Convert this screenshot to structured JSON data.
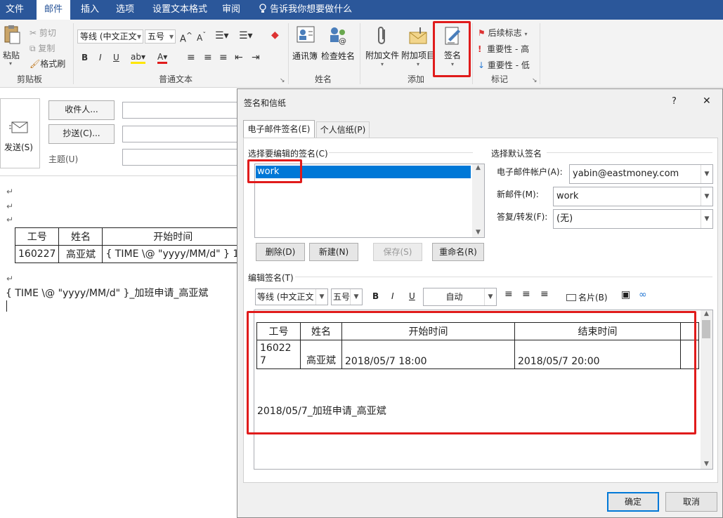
{
  "menu": {
    "tabs": [
      "文件",
      "邮件",
      "插入",
      "选项",
      "设置文本格式",
      "审阅"
    ],
    "tell_me": "告诉我你想要做什么"
  },
  "ribbon": {
    "clipboard": {
      "paste": "粘贴",
      "cut": "剪切",
      "copy": "复制",
      "format_painter": "格式刷",
      "label": "剪贴板"
    },
    "basic_text": {
      "font": "等线 (中文正文",
      "size": "五号",
      "label": "普通文本"
    },
    "names": {
      "address_book": "通讯簿",
      "check_names": "检查姓名",
      "label": "姓名"
    },
    "include": {
      "attach_file": "附加文件",
      "attach_item": "附加项目",
      "signature": "签名",
      "label": "添加"
    },
    "tags": {
      "follow_up": "后续标志",
      "high": "重要性 - 高",
      "low": "重要性 - 低",
      "label": "标记"
    }
  },
  "compose": {
    "send": "发送(S)",
    "to": "收件人...",
    "cc": "抄送(C)...",
    "subject": "主题(U)",
    "table": {
      "headers": [
        "工号",
        "姓名",
        "开始时间"
      ],
      "row": [
        "160227",
        "高亚斌",
        "{ TIME \\@ \"yyyy/MM/d\" } 1"
      ]
    },
    "body_line": "{ TIME \\@ \"yyyy/MM/d\" }_加班申请_高亚斌"
  },
  "dialog": {
    "title": "签名和信纸",
    "help": "?",
    "close": "✕",
    "tabs": [
      "电子邮件签名(E)",
      "个人信纸(P)"
    ],
    "select_label": "选择要编辑的签名(C)",
    "signatures": [
      "work"
    ],
    "buttons": {
      "delete": "删除(D)",
      "new": "新建(N)",
      "save": "保存(S)",
      "rename": "重命名(R)"
    },
    "default_label": "选择默认签名",
    "account_label": "电子邮件帐户(A):",
    "account_value": "yabin@eastmoney.com",
    "new_msg_label": "新邮件(M):",
    "new_msg_value": "work",
    "reply_label": "答复/转发(F):",
    "reply_value": "(无)",
    "edit_label": "编辑签名(T)",
    "edit_toolbar": {
      "font": "等线 (中文正文",
      "size": "五号",
      "bold": "B",
      "italic": "I",
      "underline": "U",
      "color": "自动",
      "business_card": "名片(B)"
    },
    "sig_table": {
      "headers": [
        "工号",
        "姓名",
        "开始时间",
        "结束时间"
      ],
      "row": [
        "160227",
        "高亚斌",
        "2018/05/7  18:00",
        "2018/05/7  20:00"
      ]
    },
    "sig_line": "2018/05/7_加班申请_高亚斌",
    "ok": "确定",
    "cancel": "取消"
  },
  "colors": {
    "accent": "#2b579a",
    "highlight": "#e01b1b",
    "selection": "#0078d7"
  }
}
